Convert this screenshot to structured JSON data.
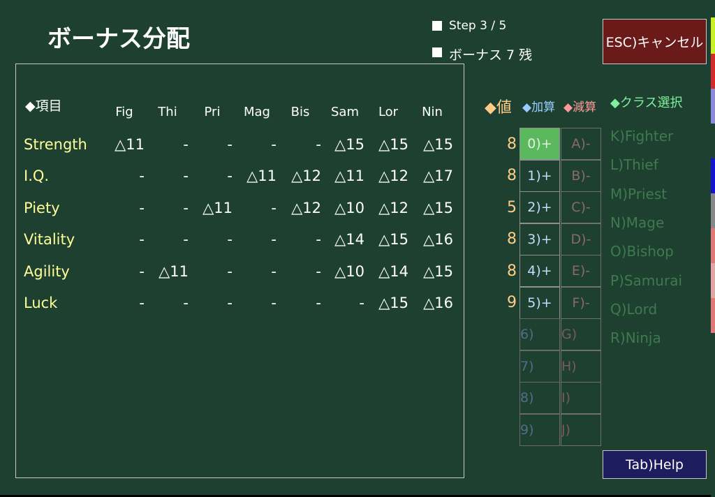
{
  "title": "ボーナス分配",
  "step": "Step 3 / 5",
  "bonus": "ボーナス 7 残",
  "cancel_button": "ESC)キャンセル",
  "help_button": "Tab)Help",
  "table": {
    "header_label": "◆項目",
    "columns": [
      "Fig",
      "Thi",
      "Pri",
      "Mag",
      "Bis",
      "Sam",
      "Lor",
      "Nin"
    ],
    "rows": [
      {
        "label": "Strength",
        "cells": [
          "△11",
          "-",
          "-",
          "-",
          "-",
          "△15",
          "△15",
          "△15"
        ]
      },
      {
        "label": "I.Q.",
        "cells": [
          "-",
          "-",
          "-",
          "△11",
          "△12",
          "△11",
          "△12",
          "△17"
        ]
      },
      {
        "label": "Piety",
        "cells": [
          "-",
          "-",
          "△11",
          "-",
          "△12",
          "△10",
          "△12",
          "△15"
        ]
      },
      {
        "label": "Vitality",
        "cells": [
          "-",
          "-",
          "-",
          "-",
          "-",
          "△14",
          "△15",
          "△16"
        ]
      },
      {
        "label": "Agility",
        "cells": [
          "-",
          "△11",
          "-",
          "-",
          "-",
          "△10",
          "△14",
          "△15"
        ]
      },
      {
        "label": "Luck",
        "cells": [
          "-",
          "-",
          "-",
          "-",
          "-",
          "-",
          "△15",
          "△16"
        ]
      }
    ]
  },
  "values_header": "◆値",
  "add_header": "◆加算",
  "sub_header": "◆減算",
  "class_header": "◆クラス選択",
  "values": [
    "8",
    "8",
    "5",
    "8",
    "8",
    "9"
  ],
  "plus_buttons": [
    "0)+",
    "1)+",
    "2)+",
    "3)+",
    "4)+",
    "5)+",
    "6)",
    "7)",
    "8)",
    "9)"
  ],
  "minus_buttons": [
    "A)-",
    "B)-",
    "C)-",
    "D)-",
    "E)-",
    "F)-",
    "G)",
    "H)",
    "I)",
    "J)"
  ],
  "classes": [
    "K)Fighter",
    "L)Thief",
    "M)Priest",
    "N)Mage",
    "O)Bishop",
    "P)Samurai",
    "Q)Lord",
    "R)Ninja"
  ],
  "colors": {
    "background": "#1e4030",
    "selected": "#5cb85c",
    "cancel": "#6b1a1a",
    "help": "#1c1c5e",
    "row_label": "#ffff99",
    "value": "#ffcc88",
    "add": "#99ccff",
    "sub": "#ff9999",
    "class_header": "#7ff09a"
  }
}
